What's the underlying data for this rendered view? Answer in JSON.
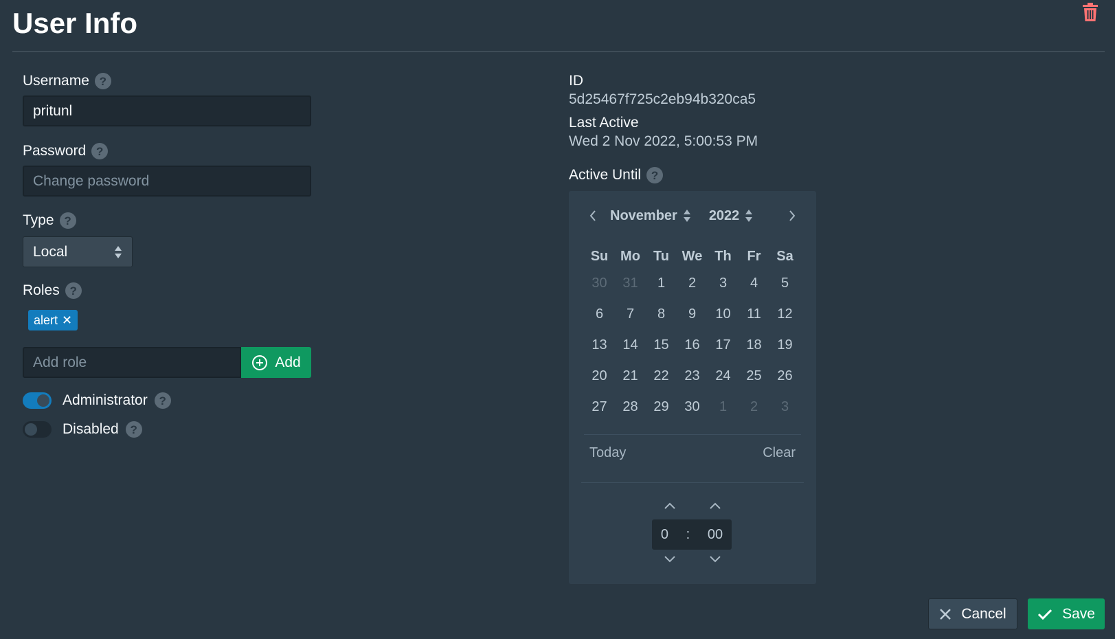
{
  "header": {
    "title": "User Info"
  },
  "form": {
    "username": {
      "label": "Username",
      "value": "pritunl"
    },
    "password": {
      "label": "Password",
      "placeholder": "Change password"
    },
    "type": {
      "label": "Type",
      "value": "Local"
    },
    "roles": {
      "label": "Roles",
      "tags": [
        "alert"
      ],
      "placeholder": "Add role",
      "add_label": "Add"
    },
    "administrator": {
      "label": "Administrator",
      "enabled": true
    },
    "disabled": {
      "label": "Disabled",
      "enabled": false
    }
  },
  "info": {
    "id_label": "ID",
    "id_value": "5d25467f725c2eb94b320ca5",
    "last_active_label": "Last Active",
    "last_active_value": "Wed 2 Nov 2022, 5:00:53 PM",
    "active_until_label": "Active Until"
  },
  "calendar": {
    "month": "November",
    "year": "2022",
    "weekdays": [
      "Su",
      "Mo",
      "Tu",
      "We",
      "Th",
      "Fr",
      "Sa"
    ],
    "weeks": [
      [
        "30",
        "31",
        "1",
        "2",
        "3",
        "4",
        "5"
      ],
      [
        "6",
        "7",
        "8",
        "9",
        "10",
        "11",
        "12"
      ],
      [
        "13",
        "14",
        "15",
        "16",
        "17",
        "18",
        "19"
      ],
      [
        "20",
        "21",
        "22",
        "23",
        "24",
        "25",
        "26"
      ],
      [
        "27",
        "28",
        "29",
        "30",
        "1",
        "2",
        "3"
      ]
    ],
    "today_label": "Today",
    "clear_label": "Clear",
    "hour": "0",
    "minute": "00",
    "separator": ":"
  },
  "footer": {
    "cancel_label": "Cancel",
    "save_label": "Save"
  },
  "colors": {
    "accent": "#137cbd",
    "success": "#0f9960",
    "danger": "#ff7373",
    "background": "#293742"
  }
}
